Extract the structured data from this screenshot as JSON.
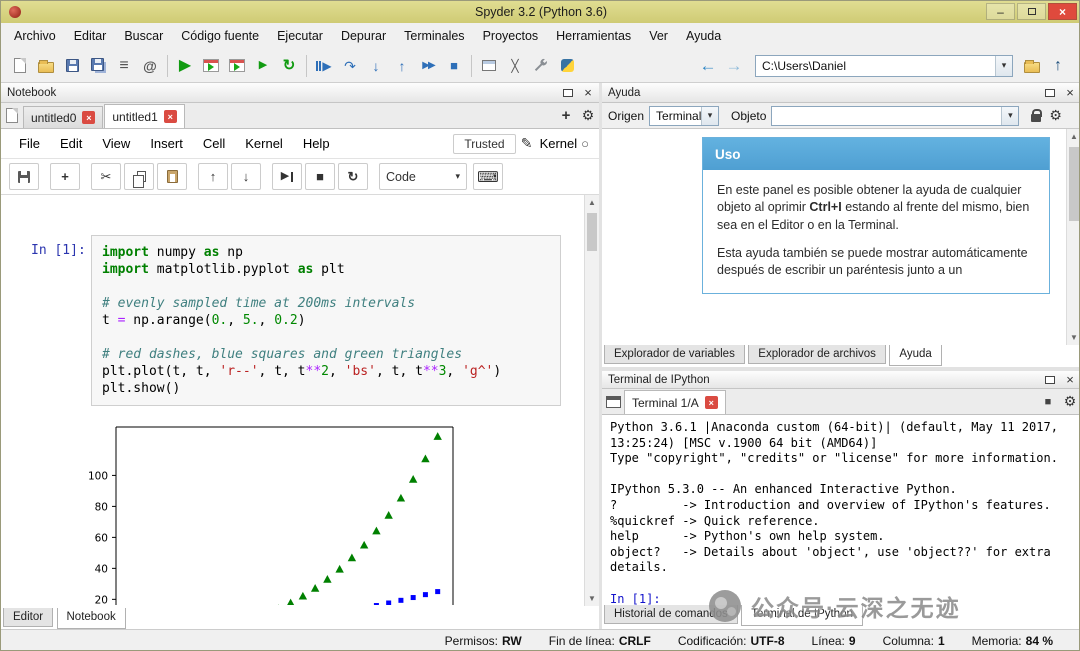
{
  "window": {
    "title": "Spyder 3.2 (Python 3.6)"
  },
  "icons": {
    "min": "–",
    "close": "×",
    "list": "≡",
    "at": "@",
    "run": "▶",
    "rerun": "↻",
    "step": "↷",
    "step_in": "↓",
    "step_out": "↑",
    "continue": "▶▶",
    "stop": "■",
    "fullscreen": "╳",
    "back": "←",
    "forward": "→",
    "updir": "↑",
    "plus": "+",
    "gear": "⚙",
    "scissors": "✂",
    "up": "↑",
    "down": "↓",
    "restart": "↻",
    "keyboard": "⌨",
    "pencil": "✎",
    "kernel_circle": "○",
    "dropdown": "▾",
    "sq_up": "▲",
    "sq_down": "▼",
    "options_square": "■"
  },
  "menubar": {
    "items": [
      "Archivo",
      "Editar",
      "Buscar",
      "Código fuente",
      "Ejecutar",
      "Depurar",
      "Terminales",
      "Proyectos",
      "Herramientas",
      "Ver",
      "Ayuda"
    ]
  },
  "toolbar": {
    "path_value": "C:\\Users\\Daniel"
  },
  "notebook": {
    "panel_title": "Notebook",
    "tabs": [
      {
        "label": "untitled0"
      },
      {
        "label": "untitled1"
      }
    ],
    "menu": [
      "File",
      "Edit",
      "View",
      "Insert",
      "Cell",
      "Kernel",
      "Help"
    ],
    "trusted_label": "Trusted",
    "kernel_label": "Kernel",
    "celltype_value": "Code",
    "cell": {
      "prompt": "In [1]:",
      "code_tokens": [
        [
          [
            "kw",
            "import"
          ],
          [
            "pl",
            " numpy "
          ],
          [
            "kw",
            "as"
          ],
          [
            "pl",
            " np"
          ]
        ],
        [
          [
            "kw",
            "import"
          ],
          [
            "pl",
            " matplotlib.pyplot "
          ],
          [
            "kw",
            "as"
          ],
          [
            "pl",
            " plt"
          ]
        ],
        [],
        [
          [
            "cm",
            "# evenly sampled time at 200ms intervals"
          ]
        ],
        [
          [
            "pl",
            "t "
          ],
          [
            "op",
            "="
          ],
          [
            "pl",
            " np.arange("
          ],
          [
            "nb",
            "0."
          ],
          [
            "pl",
            ", "
          ],
          [
            "nb",
            "5."
          ],
          [
            "pl",
            ", "
          ],
          [
            "nb",
            "0.2"
          ],
          [
            "pl",
            ")"
          ]
        ],
        [],
        [
          [
            "cm",
            "# red dashes, blue squares and green triangles"
          ]
        ],
        [
          [
            "pl",
            "plt.plot(t, t, "
          ],
          [
            "st",
            "'r--'"
          ],
          [
            "pl",
            ", t, t"
          ],
          [
            "op",
            "**"
          ],
          [
            "nb",
            "2"
          ],
          [
            "pl",
            ", "
          ],
          [
            "st",
            "'bs'"
          ],
          [
            "pl",
            ", t, t"
          ],
          [
            "op",
            "**"
          ],
          [
            "nb",
            "3"
          ],
          [
            "pl",
            ", "
          ],
          [
            "st",
            "'g^'"
          ],
          [
            "pl",
            ")"
          ]
        ],
        [
          [
            "pl",
            "plt.show()"
          ]
        ]
      ]
    },
    "dock_tabs": [
      "Editor",
      "Notebook"
    ]
  },
  "help": {
    "panel_title": "Ayuda",
    "origen_label": "Origen",
    "origen_value": "Terminal",
    "objeto_label": "Objeto",
    "uso": {
      "title": "Uso",
      "p1_pre": "En este panel es posible obtener la ayuda de cualquier objeto al oprimir ",
      "p1_bold": "Ctrl+I",
      "p1_post": " estando al frente del mismo, bien sea en el Editor o en la Terminal.",
      "p2": "Esta ayuda también se puede mostrar automáticamente después de escribir un paréntesis junto a un"
    },
    "tabs": [
      "Explorador de variables",
      "Explorador de archivos",
      "Ayuda"
    ]
  },
  "terminal": {
    "panel_title": "Terminal de IPython",
    "tab_label": "Terminal 1/A",
    "lines": [
      "Python 3.6.1 |Anaconda custom (64-bit)| (default, May 11 2017,",
      "13:25:24) [MSC v.1900 64 bit (AMD64)]",
      "Type \"copyright\", \"credits\" or \"license\" for more information.",
      "",
      "IPython 5.3.0 -- An enhanced Interactive Python.",
      "?         -> Introduction and overview of IPython's features.",
      "%quickref -> Quick reference.",
      "help      -> Python's own help system.",
      "object?   -> Details about 'object', use 'object??' for extra",
      "details.",
      ""
    ],
    "prompt": "In [1]:",
    "bottom_tabs": [
      "Historial de comandos",
      "Terminal de IPython"
    ]
  },
  "statusbar": {
    "items": [
      {
        "label": "Permisos:",
        "value": "RW"
      },
      {
        "label": "Fin de línea:",
        "value": "CRLF"
      },
      {
        "label": "Codificación:",
        "value": "UTF-8"
      },
      {
        "label": "Línea:",
        "value": "9"
      },
      {
        "label": "Columna:",
        "value": "1"
      },
      {
        "label": "Memoria:",
        "value": "84 %"
      }
    ]
  },
  "watermark": {
    "text": "公众号·云深之无迹"
  },
  "chart_data": {
    "type": "scatter",
    "title": "",
    "xlabel": "",
    "ylabel": "",
    "x_start": 0,
    "x_stop": 5,
    "x_step": 0.2,
    "xlim": [
      -0.25,
      5.25
    ],
    "ylim": [
      -6.25,
      131.25
    ],
    "yticks": [
      20,
      40,
      60,
      80,
      100
    ],
    "series": [
      {
        "name": "t",
        "marker": "dashed-line",
        "color": "#ff0000",
        "power": 1
      },
      {
        "name": "t**2",
        "marker": "square",
        "color": "#0000ff",
        "power": 2
      },
      {
        "name": "t**3",
        "marker": "triangle",
        "color": "#008000",
        "power": 3
      }
    ]
  }
}
